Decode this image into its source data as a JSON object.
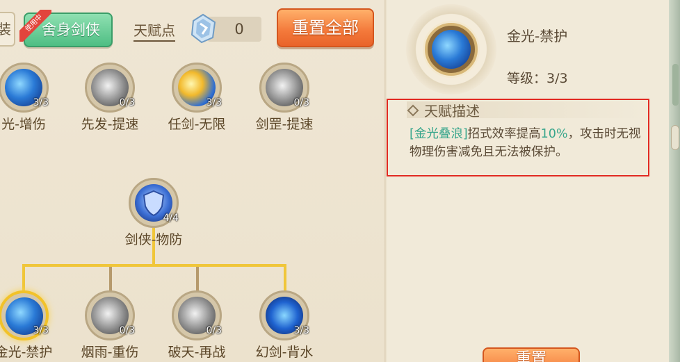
{
  "topbar": {
    "partial_tab": "装",
    "build_button": "舍身剑侠",
    "in_use_ribbon": "使用中",
    "talent_points_label": "天赋点",
    "talent_points_value": "0",
    "reset_all": "重置全部"
  },
  "tree": {
    "row1": [
      {
        "name": "光-增伤",
        "level": "3/3"
      },
      {
        "name": "先发-提速",
        "level": "0/3"
      },
      {
        "name": "任剑-无限",
        "level": "3/3"
      },
      {
        "name": "剑罡-提速",
        "level": "0/3"
      }
    ],
    "mid": {
      "name": "剑侠-物防",
      "level": "4/4"
    },
    "row3": [
      {
        "name": "金光-禁护",
        "level": "3/3"
      },
      {
        "name": "烟雨-重伤",
        "level": "0/3"
      },
      {
        "name": "破天-再战",
        "level": "0/3"
      },
      {
        "name": "幻剑-背水",
        "level": "3/3"
      }
    ]
  },
  "panel": {
    "talent_name": "金光-禁护",
    "level_text": "等级：3/3",
    "desc_header": "天赋描述",
    "desc_tag": "[金光叠浪]",
    "desc_part1": "招式效率提高",
    "desc_percent": "10%",
    "desc_part2": "，攻击时无视物理伤害减免且无法被保护。",
    "reset_button": "重置"
  },
  "colors": {
    "highlight": "#38a68c",
    "accent_orange": "#f3783a",
    "selection_border": "#e22a22",
    "active_line": "#f0c63a"
  }
}
